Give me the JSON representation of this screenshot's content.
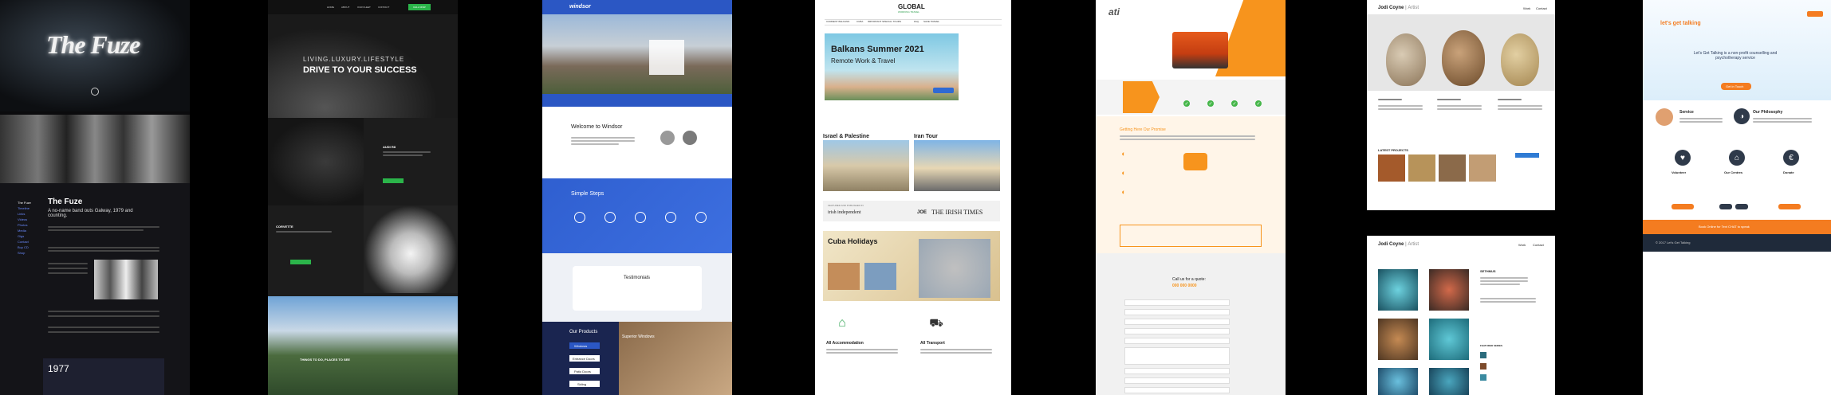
{
  "s1": {
    "logo": "The Fuze",
    "heading": "The Fuze",
    "subheading": "A no-name band outs Galway, 1979 and counting.",
    "year": "1977",
    "nav": [
      "The Fuze",
      "Timeline",
      "Links",
      "Videos",
      "Photos",
      "Media",
      "Gigs",
      "Contact",
      "Buy CD",
      "Shop"
    ]
  },
  "s2": {
    "tagline": "LIVING.LUXURY.LIFESTYLE",
    "headline": "DRIVE TO YOUR SUCCESS",
    "car1": "AUDI R8",
    "car2": "CORVETTE",
    "section3": "THINGS TO DO, PLACES TO SEE",
    "nav": [
      "HOME",
      "ABOUT",
      "OUR FLEET",
      "CONTACT"
    ],
    "cta": "CALL NOW",
    "btn": "READ MORE",
    "accent": "#2bb44a"
  },
  "s3": {
    "brand": "windsor",
    "welcome": "Welcome to Windsor",
    "simple_steps": "Simple Steps",
    "testimonials": "Testimonials",
    "our_products": "Our Products",
    "superior": "Superior Windows",
    "products": [
      "Windows",
      "Entrance Doors",
      "Patio Doors",
      "Siding"
    ],
    "accent": "#2b57c4"
  },
  "s4": {
    "logo": "GLOBAL",
    "logo_sub": "WORKING TRAVEL",
    "nav": [
      "CURRENT BALKANS",
      "CUBA",
      "IMPORTANT SPECIAL TOURS",
      "FAQ",
      "SAFE TRAVEL"
    ],
    "hero_title": "Balkans Summer 2021",
    "hero_sub": "Remote Work & Travel",
    "card1": "Israel & Palestine",
    "card2": "Iran Tour",
    "press_label": "FEATURED AND PUBLISHED IN",
    "press": [
      "irish independent",
      "THE IRISH TIMES",
      "JOE"
    ],
    "cuba": "Cuba Holidays",
    "feat1": "All Accommodation",
    "feat2": "All Transport"
  },
  "s5": {
    "logo": "ati",
    "callout": "Call us for a quote:",
    "phone": "000 000 0000",
    "section": "Getting Here Our Promise",
    "accent": "#f7941d"
  },
  "s6": {
    "brand": "Jodi Coyne",
    "role": "Artist",
    "nav": [
      "Work",
      "Contact"
    ],
    "latest": "LATEST PROJECTS",
    "btn": "Read More"
  },
  "s7": {
    "brand": "Jodi Coyne",
    "role": "Artist",
    "nav": [
      "Work",
      "Contact"
    ],
    "section": "SETHMUS",
    "featured": "FEATURED SERIES"
  },
  "s8": {
    "logo": "let's get talking",
    "intro": "Let's Get Talking is a non-profit counselling and psychotherapy service",
    "btn": "Get in Touch",
    "col1": "Service",
    "col2": "Our Philosophy",
    "col3": "Volunteer",
    "col4": "Our Centres",
    "col5": "Donate",
    "footer_cta": "Book Online for Text CHAT to speak",
    "footer_copy": "© 2017 Let's Get Talking",
    "accent": "#f47c20"
  }
}
